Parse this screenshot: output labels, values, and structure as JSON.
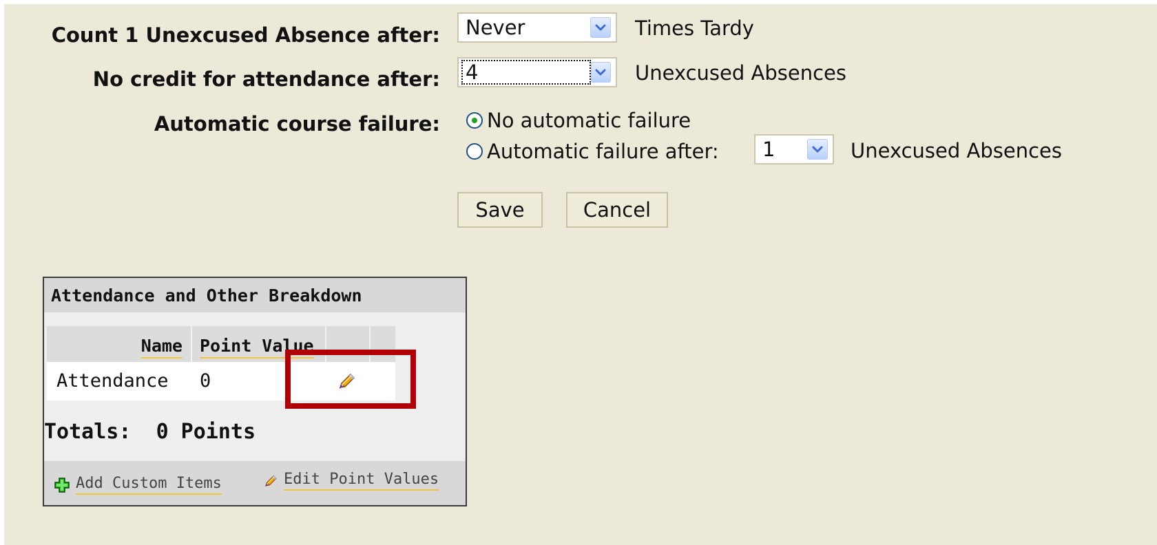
{
  "settings": {
    "rows": [
      {
        "label": "Count 1 Unexcused Absence after:",
        "select_value": "Never",
        "trailing_text": "Times Tardy"
      },
      {
        "label": "No credit for attendance after:",
        "select_value": "4",
        "trailing_text": "Unexcused Absences"
      }
    ],
    "failure": {
      "label": "Automatic course failure:",
      "option_none": "No automatic failure",
      "option_after": "Automatic failure after:",
      "select_value": "1",
      "trailing_text": "Unexcused Absences",
      "selected": "none"
    }
  },
  "buttons": {
    "save": "Save",
    "cancel": "Cancel"
  },
  "breakdown": {
    "title": "Attendance and Other Breakdown",
    "columns": [
      "Name",
      "Point Value"
    ],
    "rows": [
      {
        "name": "Attendance",
        "value": "0"
      }
    ],
    "totals_label": "Totals:",
    "totals_value": "0 Points",
    "add_custom_items": "Add Custom Items",
    "edit_point_values": "Edit Point Values"
  },
  "colors": {
    "page_background": "#ece9d8",
    "panel_border": "#3a3a3a",
    "highlight": "#b10005",
    "link_underline": "#f0c53c"
  },
  "icons": {
    "dropdown": "chevron-down-icon",
    "edit": "pencil-icon",
    "add": "plus-icon"
  }
}
